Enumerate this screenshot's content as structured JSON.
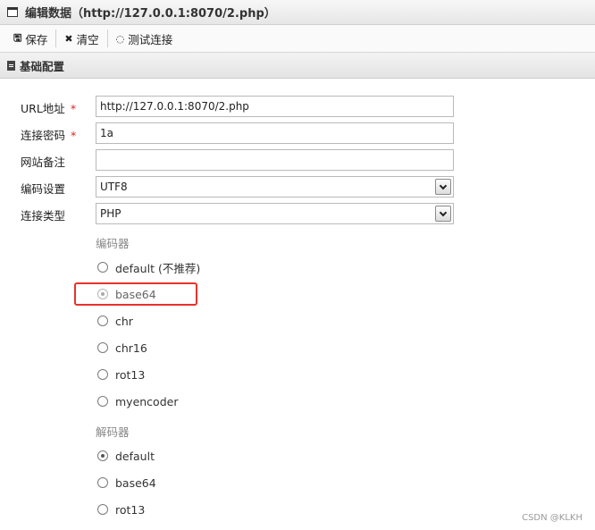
{
  "window": {
    "title": "编辑数据（http://127.0.0.1:8070/2.php）",
    "icon": "window-icon"
  },
  "toolbar": {
    "save_label": "保存",
    "save_icon": "save-icon",
    "clear_label": "清空",
    "clear_icon": "close-icon",
    "test_label": "测试连接",
    "test_icon": "spinner-icon"
  },
  "section": {
    "label": "基础配置",
    "icon": "document-icon"
  },
  "form": {
    "url": {
      "label": "URL地址",
      "required_mark": "*",
      "value": "http://127.0.0.1:8070/2.php"
    },
    "password": {
      "label": "连接密码",
      "required_mark": "*",
      "value": "1a"
    },
    "note": {
      "label": "网站备注",
      "value": ""
    },
    "encoding": {
      "label": "编码设置",
      "value": "UTF8"
    },
    "type": {
      "label": "连接类型",
      "value": "PHP"
    }
  },
  "encoders": {
    "label": "编码器",
    "options": [
      "default (不推荐)",
      "base64",
      "chr",
      "chr16",
      "rot13",
      "myencoder"
    ],
    "selected": "base64"
  },
  "decoders": {
    "label": "解码器",
    "options": [
      "default",
      "base64",
      "rot13"
    ],
    "selected": "default"
  },
  "watermark": "CSDN @KLKH",
  "colors": {
    "highlight": "#e8322b",
    "required": "#e02020"
  }
}
